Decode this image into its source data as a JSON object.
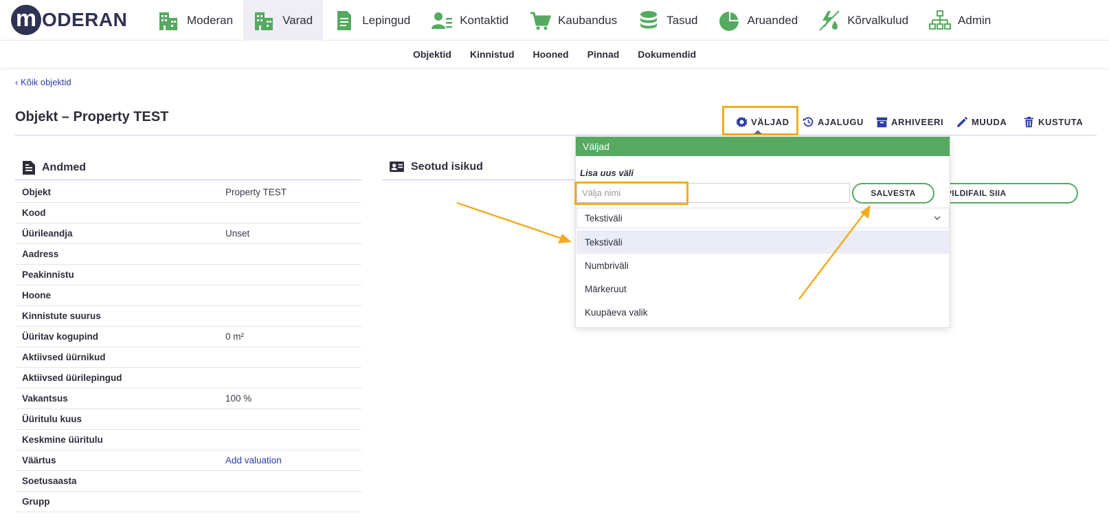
{
  "brand": {
    "logo_letter": "m",
    "logo_text": "ODERAN",
    "accent": "#55aa5f",
    "dark": "#2f3254",
    "highlight": "#f0ac1f",
    "link": "#2c3ea6"
  },
  "nav": {
    "items": [
      {
        "label": "Moderan",
        "icon": "buildings-icon"
      },
      {
        "label": "Varad",
        "icon": "buildings-icon",
        "active": true
      },
      {
        "label": "Lepingud",
        "icon": "document-icon"
      },
      {
        "label": "Kontaktid",
        "icon": "contact-icon"
      },
      {
        "label": "Kaubandus",
        "icon": "cart-icon"
      },
      {
        "label": "Tasud",
        "icon": "coins-icon"
      },
      {
        "label": "Aruanded",
        "icon": "pie-chart-icon"
      },
      {
        "label": "Kõrvalkulud",
        "icon": "utilities-icon"
      },
      {
        "label": "Admin",
        "icon": "org-chart-icon"
      }
    ]
  },
  "subnav": {
    "items": [
      "Objektid",
      "Kinnistud",
      "Hooned",
      "Pinnad",
      "Dokumendid"
    ]
  },
  "back_link": "‹ Kõik objektid",
  "page": {
    "title": "Objekt – Property TEST"
  },
  "actions": {
    "fields": "VÄLJAD",
    "history": "AJALUGU",
    "archive": "ARHIVEERI",
    "edit": "MUUDA",
    "delete": "KUSTUTA"
  },
  "andmed": {
    "title": "Andmed",
    "rows": [
      {
        "key": "Objekt",
        "value": "Property TEST"
      },
      {
        "key": "Kood",
        "value": ""
      },
      {
        "key": "Üürileandja",
        "value": "Unset"
      },
      {
        "key": "Aadress",
        "value": ""
      },
      {
        "key": "Peakinnistu",
        "value": ""
      },
      {
        "key": "Hoone",
        "value": ""
      },
      {
        "key": "Kinnistute suurus",
        "value": ""
      },
      {
        "key": "Üüritav kogupind",
        "value": "0 m²"
      },
      {
        "key": "Aktiivsed üürnikud",
        "value": ""
      },
      {
        "key": "Aktiivsed üürilepingud",
        "value": ""
      },
      {
        "key": "Vakantsus",
        "value": "100 %"
      },
      {
        "key": "Üüritulu kuus",
        "value": ""
      },
      {
        "key": "Keskmine üüritulu",
        "value": ""
      },
      {
        "key": "Väärtus",
        "value": "Add valuation",
        "link": true
      },
      {
        "key": "Soetusaasta",
        "value": ""
      },
      {
        "key": "Grupp",
        "value": ""
      }
    ]
  },
  "seotud": {
    "title": "Seotud isikud"
  },
  "upload_button": "PILDIFAIL SIIA",
  "popover": {
    "header": "Väljad",
    "label": "Lisa uus väli",
    "input_placeholder": "Välja nimi",
    "save_button": "SALVESTA",
    "selected_type": "Tekstiväli",
    "options": [
      "Tekstiväli",
      "Numbriväli",
      "Märkeruut",
      "Kuupäeva valik"
    ]
  }
}
